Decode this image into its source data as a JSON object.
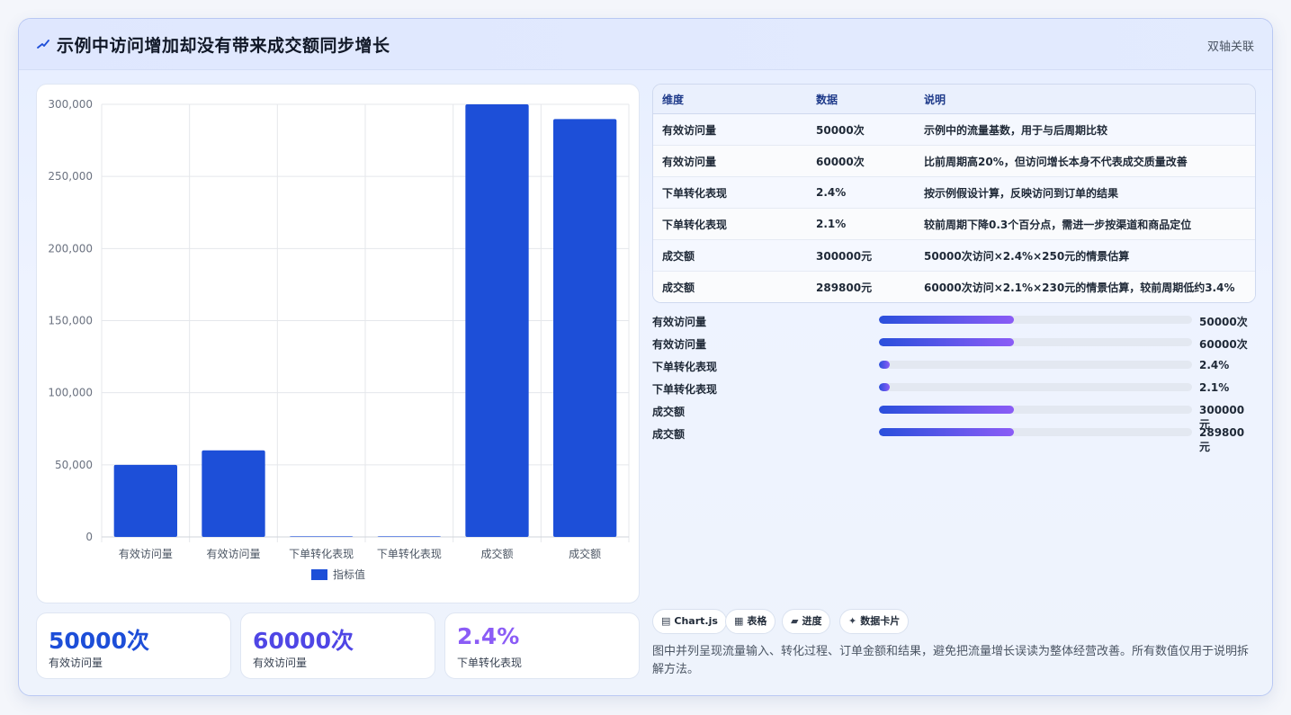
{
  "header": {
    "title": "示例中访问增加却没有带来成交额同步增长",
    "tag": "双轴关联"
  },
  "chart_data": {
    "type": "bar",
    "categories": [
      "有效访问量",
      "有效访问量",
      "下单转化表现",
      "下单转化表现",
      "成交额",
      "成交额"
    ],
    "series": [
      {
        "name": "指标值",
        "values": [
          50000,
          60000,
          2.4,
          2.1,
          300000,
          289800
        ]
      }
    ],
    "ylim": [
      0,
      300000
    ],
    "yticks": [
      "300,000",
      "250,000",
      "200,000",
      "150,000",
      "100,000",
      "50,000",
      "0"
    ],
    "ytick_values": [
      300000,
      250000,
      200000,
      150000,
      100000,
      50000,
      0
    ],
    "legend_position": "bottom",
    "grid": true,
    "colors": {
      "bar": "#1d4fd8"
    }
  },
  "table": {
    "headers": [
      "维度",
      "数据",
      "说明"
    ],
    "rows": [
      [
        "有效访问量",
        "50000次",
        "示例中的流量基数，用于与后周期比较"
      ],
      [
        "有效访问量",
        "60000次",
        "比前周期高20%，但访问增长本身不代表成交质量改善"
      ],
      [
        "下单转化表现",
        "2.4%",
        "按示例假设计算，反映访问到订单的结果"
      ],
      [
        "下单转化表现",
        "2.1%",
        "较前周期下降0.3个百分点，需进一步按渠道和商品定位"
      ],
      [
        "成交额",
        "300000元",
        "50000次访问×2.4%×250元的情景估算"
      ],
      [
        "成交额",
        "289800元",
        "60000次访问×2.1%×230元的情景估算，较前周期低约3.4%"
      ]
    ]
  },
  "progress": [
    {
      "label": "有效访问量",
      "value": "50000次",
      "fraction": 0.43
    },
    {
      "label": "有效访问量",
      "value": "60000次",
      "fraction": 0.43
    },
    {
      "label": "下单转化表现",
      "value": "2.4%",
      "fraction": 0.035
    },
    {
      "label": "下单转化表现",
      "value": "2.1%",
      "fraction": 0.035
    },
    {
      "label": "成交额",
      "value": "300000元",
      "fraction": 0.43
    },
    {
      "label": "成交额",
      "value": "289800元",
      "fraction": 0.43
    }
  ],
  "stats": [
    {
      "num": "50000次",
      "cap": "有效访问量",
      "color": "#1d4ed8"
    },
    {
      "num": "60000次",
      "cap": "有效访问量",
      "color": "#4f46e5"
    },
    {
      "num": "2.4%",
      "cap": "下单转化表现",
      "color": "#8b5cf6"
    }
  ],
  "chips": [
    {
      "icon": "chart-icon",
      "glyph": "▤",
      "label": "Chart.js"
    },
    {
      "icon": "table-icon",
      "glyph": "▦",
      "label": "表格"
    },
    {
      "icon": "progress-icon",
      "glyph": "▰",
      "label": "进度"
    },
    {
      "icon": "card-icon",
      "glyph": "✦",
      "label": "数据卡片"
    }
  ],
  "description": "图中并列呈现流量输入、转化过程、订单金额和结果，避免把流量增长误读为整体经营改善。所有数值仅用于说明拆解方法。"
}
